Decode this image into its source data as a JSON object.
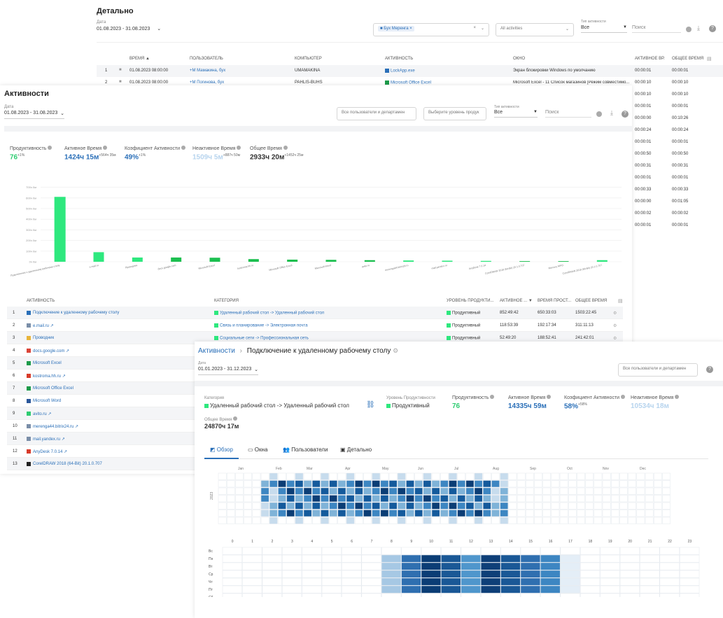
{
  "detail": {
    "title": "Детально",
    "date_label": "Дата",
    "date_value": "01.08.2023 - 31.08.2023",
    "group_chip": "Бух Меренга",
    "activities_placeholder": "All activities",
    "type_label": "Тип активности",
    "type_value": "Все",
    "search_placeholder": "Поиск",
    "columns": [
      "Время",
      "Пользователь",
      "Компьютер",
      "Активность",
      "Окно",
      "Активное вр.",
      "Общее время"
    ],
    "rows": [
      {
        "n": "1",
        "time": "01.08.2023 08:00:00",
        "user": "+М Мамакина, бух",
        "computer": "UMAMAKINA",
        "activity": "LockApp.exe",
        "window": "Экран блокировки Windows по умолчанию",
        "active": "00:00:01",
        "total": "00:00:01"
      },
      {
        "n": "2",
        "time": "01.08.2023 08:00:00",
        "user": "+М Погинова, бух",
        "computer": "PAHLIS-BUHS",
        "activity": "Microsoft Office Excel",
        "window": "Microsoft Excel - 11 Список магазинов [Режим совместимо...",
        "active": "00:00:10",
        "total": "00:00:10"
      }
    ],
    "extra_rows": [
      {
        "active": "00:00:10",
        "total": "00:00:10"
      },
      {
        "active": "00:00:01",
        "total": "00:00:01"
      },
      {
        "active": "00:00:00",
        "total": "00:10:26"
      },
      {
        "active": "00:00:24",
        "total": "00:00:24"
      },
      {
        "active": "00:00:01",
        "total": "00:00:01"
      },
      {
        "active": "00:00:50",
        "total": "00:00:50"
      },
      {
        "active": "00:00:31",
        "total": "00:00:31"
      },
      {
        "active": "00:00:01",
        "total": "00:00:01"
      },
      {
        "active": "00:00:33",
        "total": "00:00:33"
      },
      {
        "active": "00:00:00",
        "total": "00:01:05"
      },
      {
        "active": "00:00:02",
        "total": "00:00:02"
      },
      {
        "active": "00:00:01",
        "total": "00:00:01"
      }
    ]
  },
  "activity": {
    "title": "Активности",
    "date_label": "Дата",
    "date_value": "01.08.2023 - 31.08.2023",
    "users_placeholder": "Все пользователи и департамен",
    "level_placeholder": "Выберите уровень продук",
    "type_label": "Тип активности",
    "type_value": "Все",
    "search_placeholder": "Поиск",
    "metrics": [
      {
        "label": "Продуктивность",
        "value": "76",
        "sup": "+1%",
        "color": "#2ecc71"
      },
      {
        "label": "Активное Время",
        "value": "1424ч 15м",
        "sup": "+564ч 35м",
        "color": "#2a6fb8"
      },
      {
        "label": "Коэфициент Активности",
        "value": "49%",
        "sup": "+1%",
        "color": "#2a6fb8"
      },
      {
        "label": "Неактивное Время",
        "value": "1509ч 5м",
        "sup": "+887ч 50м",
        "color": "#b7d4ee"
      },
      {
        "label": "Общее Время",
        "value": "2933ч 20м",
        "sup": "+1452ч 25м",
        "color": "#333333"
      }
    ],
    "columns": [
      "Активность",
      "Категория",
      "Уровень продукти...",
      "Активное ...",
      "Время прост...",
      "Общее время"
    ],
    "rows": [
      {
        "n": "1",
        "icon": "rdp",
        "name": "Подключение к удаленному рабочему столу",
        "category": "Удаленный рабочий стол -> Удаленный рабочий стол",
        "level": "Продуктивный",
        "active": "852:49:42",
        "idle": "650:33:03",
        "total": "1503:22:45"
      },
      {
        "n": "2",
        "icon": "web",
        "name": "e.mail.ru",
        "category": "Связь и планирование -> Электронная почта",
        "level": "Продуктивный",
        "active": "118:53:39",
        "idle": "192:17:34",
        "total": "311:11:13"
      },
      {
        "n": "3",
        "icon": "explorer",
        "name": "Проводник",
        "category": "Социальные сети -> Профессиональная сеть",
        "level": "Продуктивный",
        "active": "52:49:20",
        "idle": "188:52:41",
        "total": "241:42:01"
      },
      {
        "n": "4",
        "icon": "google",
        "name": "docs.google.com",
        "category": "",
        "level": "",
        "active": "",
        "idle": "",
        "total": ""
      },
      {
        "n": "5",
        "icon": "excel",
        "name": "Microsoft Excel",
        "category": "",
        "level": "",
        "active": "",
        "idle": "",
        "total": ""
      },
      {
        "n": "6",
        "icon": "red",
        "name": "kostroma.hh.ru",
        "category": "",
        "level": "",
        "active": "",
        "idle": "",
        "total": ""
      },
      {
        "n": "7",
        "icon": "excel",
        "name": "Microsoft Office Excel",
        "category": "",
        "level": "",
        "active": "",
        "idle": "",
        "total": ""
      },
      {
        "n": "8",
        "icon": "word",
        "name": "Microsoft Word",
        "category": "",
        "level": "",
        "active": "",
        "idle": "",
        "total": ""
      },
      {
        "n": "9",
        "icon": "avito",
        "name": "avito.ru",
        "category": "",
        "level": "",
        "active": "",
        "idle": "",
        "total": ""
      },
      {
        "n": "10",
        "icon": "web",
        "name": "merenga44.bitrix24.ru",
        "category": "",
        "level": "",
        "active": "",
        "idle": "",
        "total": ""
      },
      {
        "n": "11",
        "icon": "web",
        "name": "mail.yandex.ru",
        "category": "",
        "level": "",
        "active": "",
        "idle": "",
        "total": ""
      },
      {
        "n": "12",
        "icon": "red",
        "name": "AnyDesk 7.0.14",
        "category": "",
        "level": "",
        "active": "",
        "idle": "",
        "total": ""
      },
      {
        "n": "13",
        "icon": "corel",
        "name": "CorelDRAW 2018 (64-Bit) 20.1.0.707",
        "category": "",
        "level": "",
        "active": "",
        "idle": "",
        "total": ""
      }
    ]
  },
  "chart_data": {
    "type": "bar",
    "y_ticks": [
      "0ч 0м",
      "100ч 0м",
      "200ч 0м",
      "300ч 0м",
      "400ч 0м",
      "500ч 0м",
      "600ч 0м",
      "700ч 0м"
    ],
    "ylim": [
      0,
      750
    ],
    "categories": [
      "Подключение к удаленному рабочему столу",
      "e.mail.ru",
      "Проводник",
      "docs.google.com",
      "Microsoft Excel",
      "kostroma.hh.ru",
      "Microsoft Office Excel",
      "Microsoft Word",
      "avito.ru",
      "merenga44.bitrix24.ru",
      "mail.yandex.ru",
      "AnyDesk 7.0.14",
      "CorelDRAW 2018 (64-Bit) 20.1.0.707",
      "Mercury MPO",
      "CorelDRAW 2018 (64-Bit) 20.1.0.707"
    ],
    "values": [
      610,
      90,
      40,
      40,
      38,
      25,
      20,
      18,
      15,
      12,
      10,
      8,
      6,
      6,
      15
    ],
    "colors": [
      "#2ee87e",
      "#2ee87e",
      "#2ee87e",
      "#1bbf4f",
      "#1bbf4f",
      "#1bbf4f",
      "#1bbf4f",
      "#1bbf4f",
      "#1bbf4f",
      "#2ee87e",
      "#2ee87e",
      "#2ee87e",
      "#1bbf4f",
      "#1bbf4f",
      "#2ee87e"
    ]
  },
  "rdp": {
    "breadcrumb_root": "Активности",
    "breadcrumb_sep": "›",
    "title": "Подключение к удаленному рабочему столу",
    "date_label": "Дата",
    "date_value": "01.01.2023 - 31.12.2023",
    "users_placeholder": "Все пользователи и департамен",
    "category_label": "Категория",
    "category_value": "Удаленный рабочий стол -> Удаленный рабочий стол",
    "level_label": "Уровень Продуктивности",
    "level_value": "Продуктивный",
    "metrics": [
      {
        "label": "Продуктивность",
        "value": "76",
        "sup": "",
        "color": "#2ecc71"
      },
      {
        "label": "Активное Время",
        "value": "14335ч 59м",
        "sup": "",
        "color": "#2a6fb8"
      },
      {
        "label": "Коэфициент Активности",
        "value": "58%",
        "sup": "+58%",
        "color": "#2a6fb8"
      },
      {
        "label": "Неактивное Время",
        "value": "10534ч 18м",
        "sup": "",
        "color": "#b7d4ee"
      }
    ],
    "total_label": "Общее Время",
    "total_value": "24870ч 17м",
    "tabs": [
      "Обзор",
      "Окна",
      "Пользователи",
      "Детально"
    ],
    "months": [
      "Jan",
      "Feb",
      "Mar",
      "Apr",
      "May",
      "Jun",
      "Jul",
      "Aug",
      "Sep",
      "Oct",
      "Nov",
      "Dec"
    ],
    "year": "2023",
    "hours": [
      "0",
      "1",
      "2",
      "3",
      "4",
      "5",
      "6",
      "7",
      "8",
      "9",
      "10",
      "11",
      "12",
      "13",
      "14",
      "15",
      "16",
      "17",
      "18",
      "19",
      "20",
      "21",
      "22",
      "23"
    ],
    "weekdays": [
      "Вс",
      "Пн",
      "Вт",
      "Ср",
      "Чт",
      "Пт",
      "Сб"
    ]
  }
}
